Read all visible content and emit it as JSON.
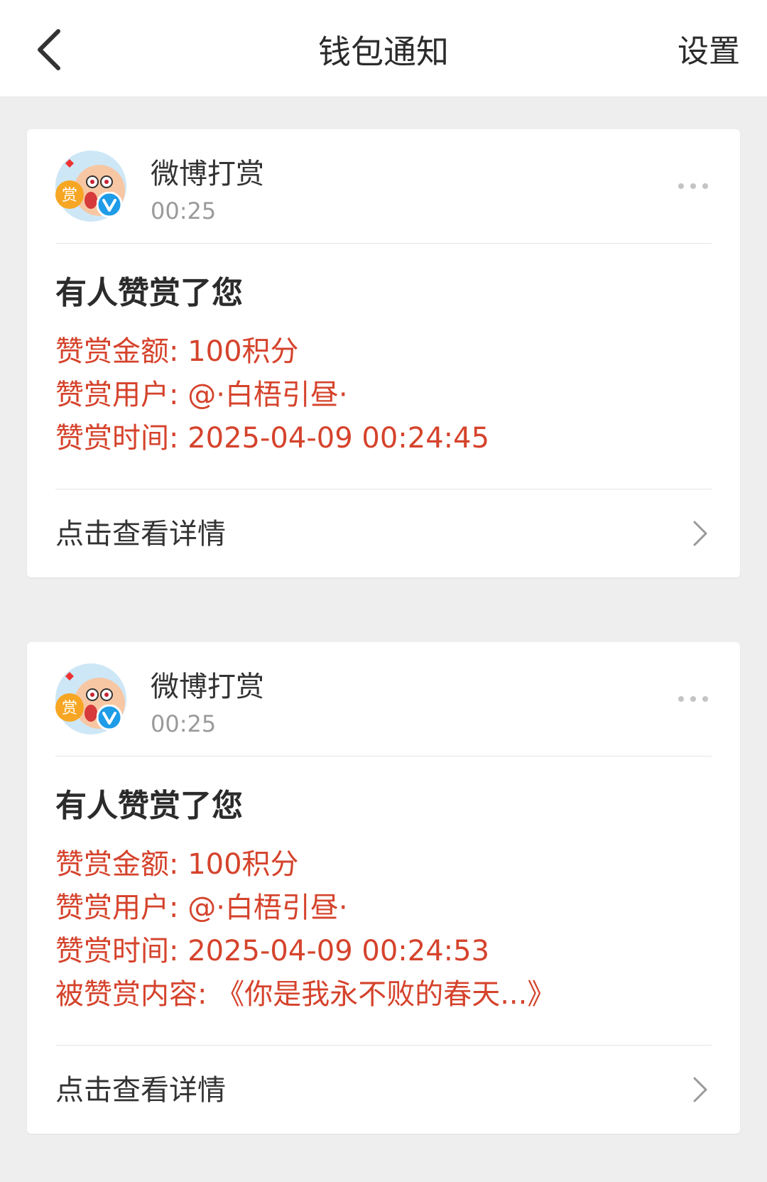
{
  "header": {
    "title": "钱包通知",
    "settings_label": "设置",
    "colors": {
      "text": "#2b2b2b",
      "background": "#ffffff"
    }
  },
  "accent_color": "#d5432c",
  "notifications": [
    {
      "sender": "微博打赏",
      "time": "00:25",
      "avatar_text": "赏",
      "title": "有人赞赏了您",
      "lines": [
        "赞赏金额: 100积分",
        "赞赏用户: @·白梧引昼·",
        "赞赏时间: 2025-04-09 00:24:45"
      ],
      "footer": "点击查看详情"
    },
    {
      "sender": "微博打赏",
      "time": "00:25",
      "avatar_text": "赏",
      "title": "有人赞赏了您",
      "lines": [
        "赞赏金额: 100积分",
        "赞赏用户: @·白梧引昼·",
        "赞赏时间: 2025-04-09 00:24:53",
        "被赞赏内容: 《你是我永不败的春天...》"
      ],
      "footer": "点击查看详情"
    }
  ],
  "icons": {
    "back": "chevron-left-icon",
    "more": "more-dots-icon",
    "verified": "verified-v-icon",
    "detail": "chevron-right-icon"
  }
}
